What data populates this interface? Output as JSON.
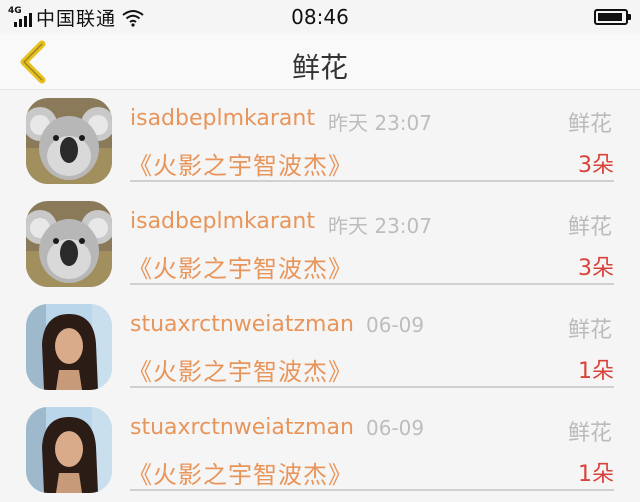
{
  "status_bar": {
    "network": "4G",
    "carrier": "中国联通",
    "time": "08:46"
  },
  "nav": {
    "title": "鲜花"
  },
  "items": [
    {
      "username": "isadbeplmkarant",
      "date": "昨天 23:07",
      "gift_label": "鲜花",
      "title": "《火影之宇智波杰》",
      "count": "3朵",
      "avatar": "koala-avatar"
    },
    {
      "username": "isadbeplmkarant",
      "date": "昨天 23:07",
      "gift_label": "鲜花",
      "title": "《火影之宇智波杰》",
      "count": "3朵",
      "avatar": "koala-avatar"
    },
    {
      "username": "stuaxrctnweiatzman",
      "date": "06-09",
      "gift_label": "鲜花",
      "title": "《火影之宇智波杰》",
      "count": "1朵",
      "avatar": "woman-avatar"
    },
    {
      "username": "stuaxrctnweiatzman",
      "date": "06-09",
      "gift_label": "鲜花",
      "title": "《火影之宇智波杰》",
      "count": "1朵",
      "avatar": "woman-avatar"
    }
  ],
  "colors": {
    "accent": "#e8955a",
    "count": "#d9423a",
    "back_arrow": "#e6c01e"
  }
}
